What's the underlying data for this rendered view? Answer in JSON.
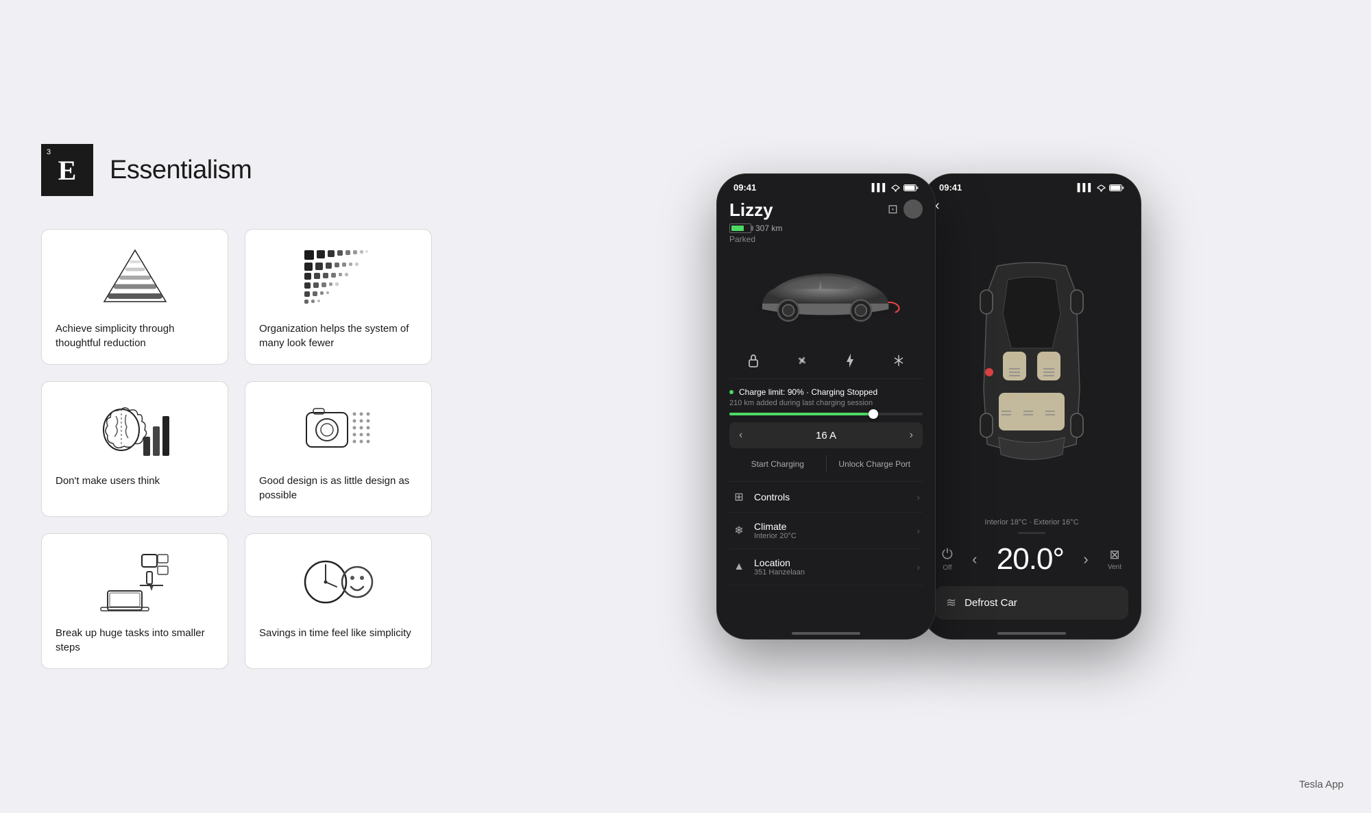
{
  "header": {
    "logo_number": "3",
    "logo_letter": "E",
    "title": "Essentialism"
  },
  "principles": [
    {
      "label": "Achieve simplicity through thoughtful reduction",
      "icon": "pyramid"
    },
    {
      "label": "Organization helps the system of many look fewer",
      "icon": "dots-grid"
    },
    {
      "label": "Don't make users think",
      "icon": "brain-bars"
    },
    {
      "label": "Good design is as little design as possible",
      "icon": "camera-dots"
    },
    {
      "label": "Break up huge tasks into smaller steps",
      "icon": "balance"
    },
    {
      "label": "Savings in time feel like simplicity",
      "icon": "clock-face"
    }
  ],
  "phone1": {
    "status_time": "09:41",
    "car_name": "Lizzy",
    "km": "307 km",
    "status": "Parked",
    "charge_limit": "Charge limit: 90%",
    "charging_status": "Charging Stopped",
    "session_text": "210 km added during last charging session",
    "amps": "16 A",
    "start_charging": "Start Charging",
    "unlock_port": "Unlock Charge Port",
    "controls_label": "Controls",
    "climate_label": "Climate",
    "climate_sub": "Interior 20°C",
    "location_label": "Location",
    "location_sub": "351 Hanzelaan"
  },
  "phone2": {
    "status_time": "09:41",
    "temp_info": "Interior 18°C · Exterior 16°C",
    "temp_display": "20.0°",
    "power_label": "Off",
    "vent_label": "Vent",
    "defrost_label": "Defrost Car"
  },
  "tesla_label": "Tesla App"
}
